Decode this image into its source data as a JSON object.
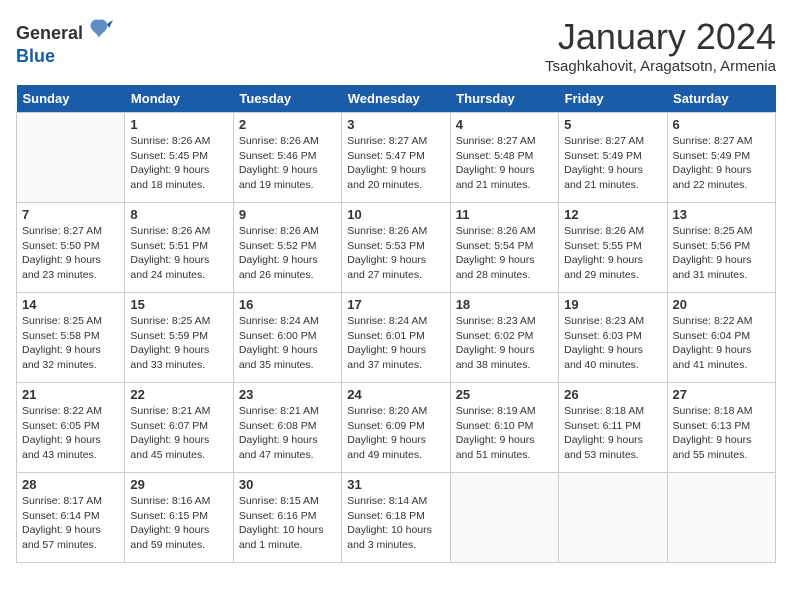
{
  "logo": {
    "general": "General",
    "blue": "Blue"
  },
  "title": "January 2024",
  "location": "Tsaghkahovit, Aragatsotn, Armenia",
  "weekdays": [
    "Sunday",
    "Monday",
    "Tuesday",
    "Wednesday",
    "Thursday",
    "Friday",
    "Saturday"
  ],
  "weeks": [
    [
      {
        "day": "",
        "text": ""
      },
      {
        "day": "1",
        "text": "Sunrise: 8:26 AM\nSunset: 5:45 PM\nDaylight: 9 hours\nand 18 minutes."
      },
      {
        "day": "2",
        "text": "Sunrise: 8:26 AM\nSunset: 5:46 PM\nDaylight: 9 hours\nand 19 minutes."
      },
      {
        "day": "3",
        "text": "Sunrise: 8:27 AM\nSunset: 5:47 PM\nDaylight: 9 hours\nand 20 minutes."
      },
      {
        "day": "4",
        "text": "Sunrise: 8:27 AM\nSunset: 5:48 PM\nDaylight: 9 hours\nand 21 minutes."
      },
      {
        "day": "5",
        "text": "Sunrise: 8:27 AM\nSunset: 5:49 PM\nDaylight: 9 hours\nand 21 minutes."
      },
      {
        "day": "6",
        "text": "Sunrise: 8:27 AM\nSunset: 5:49 PM\nDaylight: 9 hours\nand 22 minutes."
      }
    ],
    [
      {
        "day": "7",
        "text": "Sunrise: 8:27 AM\nSunset: 5:50 PM\nDaylight: 9 hours\nand 23 minutes."
      },
      {
        "day": "8",
        "text": "Sunrise: 8:26 AM\nSunset: 5:51 PM\nDaylight: 9 hours\nand 24 minutes."
      },
      {
        "day": "9",
        "text": "Sunrise: 8:26 AM\nSunset: 5:52 PM\nDaylight: 9 hours\nand 26 minutes."
      },
      {
        "day": "10",
        "text": "Sunrise: 8:26 AM\nSunset: 5:53 PM\nDaylight: 9 hours\nand 27 minutes."
      },
      {
        "day": "11",
        "text": "Sunrise: 8:26 AM\nSunset: 5:54 PM\nDaylight: 9 hours\nand 28 minutes."
      },
      {
        "day": "12",
        "text": "Sunrise: 8:26 AM\nSunset: 5:55 PM\nDaylight: 9 hours\nand 29 minutes."
      },
      {
        "day": "13",
        "text": "Sunrise: 8:25 AM\nSunset: 5:56 PM\nDaylight: 9 hours\nand 31 minutes."
      }
    ],
    [
      {
        "day": "14",
        "text": "Sunrise: 8:25 AM\nSunset: 5:58 PM\nDaylight: 9 hours\nand 32 minutes."
      },
      {
        "day": "15",
        "text": "Sunrise: 8:25 AM\nSunset: 5:59 PM\nDaylight: 9 hours\nand 33 minutes."
      },
      {
        "day": "16",
        "text": "Sunrise: 8:24 AM\nSunset: 6:00 PM\nDaylight: 9 hours\nand 35 minutes."
      },
      {
        "day": "17",
        "text": "Sunrise: 8:24 AM\nSunset: 6:01 PM\nDaylight: 9 hours\nand 37 minutes."
      },
      {
        "day": "18",
        "text": "Sunrise: 8:23 AM\nSunset: 6:02 PM\nDaylight: 9 hours\nand 38 minutes."
      },
      {
        "day": "19",
        "text": "Sunrise: 8:23 AM\nSunset: 6:03 PM\nDaylight: 9 hours\nand 40 minutes."
      },
      {
        "day": "20",
        "text": "Sunrise: 8:22 AM\nSunset: 6:04 PM\nDaylight: 9 hours\nand 41 minutes."
      }
    ],
    [
      {
        "day": "21",
        "text": "Sunrise: 8:22 AM\nSunset: 6:05 PM\nDaylight: 9 hours\nand 43 minutes."
      },
      {
        "day": "22",
        "text": "Sunrise: 8:21 AM\nSunset: 6:07 PM\nDaylight: 9 hours\nand 45 minutes."
      },
      {
        "day": "23",
        "text": "Sunrise: 8:21 AM\nSunset: 6:08 PM\nDaylight: 9 hours\nand 47 minutes."
      },
      {
        "day": "24",
        "text": "Sunrise: 8:20 AM\nSunset: 6:09 PM\nDaylight: 9 hours\nand 49 minutes."
      },
      {
        "day": "25",
        "text": "Sunrise: 8:19 AM\nSunset: 6:10 PM\nDaylight: 9 hours\nand 51 minutes."
      },
      {
        "day": "26",
        "text": "Sunrise: 8:18 AM\nSunset: 6:11 PM\nDaylight: 9 hours\nand 53 minutes."
      },
      {
        "day": "27",
        "text": "Sunrise: 8:18 AM\nSunset: 6:13 PM\nDaylight: 9 hours\nand 55 minutes."
      }
    ],
    [
      {
        "day": "28",
        "text": "Sunrise: 8:17 AM\nSunset: 6:14 PM\nDaylight: 9 hours\nand 57 minutes."
      },
      {
        "day": "29",
        "text": "Sunrise: 8:16 AM\nSunset: 6:15 PM\nDaylight: 9 hours\nand 59 minutes."
      },
      {
        "day": "30",
        "text": "Sunrise: 8:15 AM\nSunset: 6:16 PM\nDaylight: 10 hours\nand 1 minute."
      },
      {
        "day": "31",
        "text": "Sunrise: 8:14 AM\nSunset: 6:18 PM\nDaylight: 10 hours\nand 3 minutes."
      },
      {
        "day": "",
        "text": ""
      },
      {
        "day": "",
        "text": ""
      },
      {
        "day": "",
        "text": ""
      }
    ]
  ]
}
